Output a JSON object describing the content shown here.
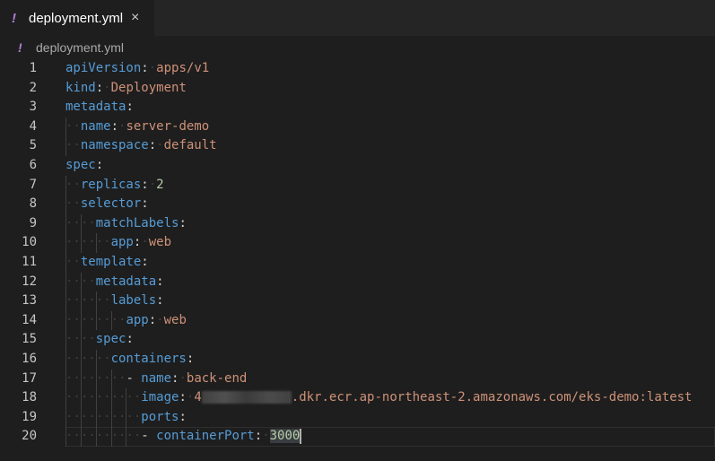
{
  "tab": {
    "icon": "yaml-file-icon",
    "title": "deployment.yml",
    "close": "×"
  },
  "breadcrumb": {
    "icon": "yaml-file-icon",
    "title": "deployment.yml"
  },
  "lines": [
    {
      "n": "1",
      "indent": "",
      "key": "apiVersion",
      "val": "apps/v1"
    },
    {
      "n": "2",
      "indent": "",
      "key": "kind",
      "val": "Deployment"
    },
    {
      "n": "3",
      "indent": "",
      "key": "metadata",
      "val": ""
    },
    {
      "n": "4",
      "indent": "··",
      "key": "name",
      "val": "server-demo"
    },
    {
      "n": "5",
      "indent": "··",
      "key": "namespace",
      "val": "default"
    },
    {
      "n": "6",
      "indent": "",
      "key": "spec",
      "val": ""
    },
    {
      "n": "7",
      "indent": "··",
      "key": "replicas",
      "val": "2",
      "num": true
    },
    {
      "n": "8",
      "indent": "··",
      "key": "selector",
      "val": ""
    },
    {
      "n": "9",
      "indent": "····",
      "key": "matchLabels",
      "val": ""
    },
    {
      "n": "10",
      "indent": "······",
      "key": "app",
      "val": "web"
    },
    {
      "n": "11",
      "indent": "··",
      "key": "template",
      "val": ""
    },
    {
      "n": "12",
      "indent": "····",
      "key": "metadata",
      "val": ""
    },
    {
      "n": "13",
      "indent": "······",
      "key": "labels",
      "val": ""
    },
    {
      "n": "14",
      "indent": "········",
      "key": "app",
      "val": "web"
    },
    {
      "n": "15",
      "indent": "····",
      "key": "spec",
      "val": ""
    },
    {
      "n": "16",
      "indent": "······",
      "key": "containers",
      "val": ""
    },
    {
      "n": "17",
      "indent": "········",
      "dash": "- ",
      "key": "name",
      "val": "back-end"
    },
    {
      "n": "18",
      "indent": "··········",
      "key": "image",
      "val": ".dkr.ecr.ap-northeast-2.amazonaws.com/eks-demo:latest",
      "redacted": "4"
    },
    {
      "n": "19",
      "indent": "··········",
      "key": "ports",
      "val": ""
    },
    {
      "n": "20",
      "indent": "··········",
      "dash": "- ",
      "key": "containerPort",
      "val": "3000",
      "num": true,
      "current": true
    }
  ]
}
